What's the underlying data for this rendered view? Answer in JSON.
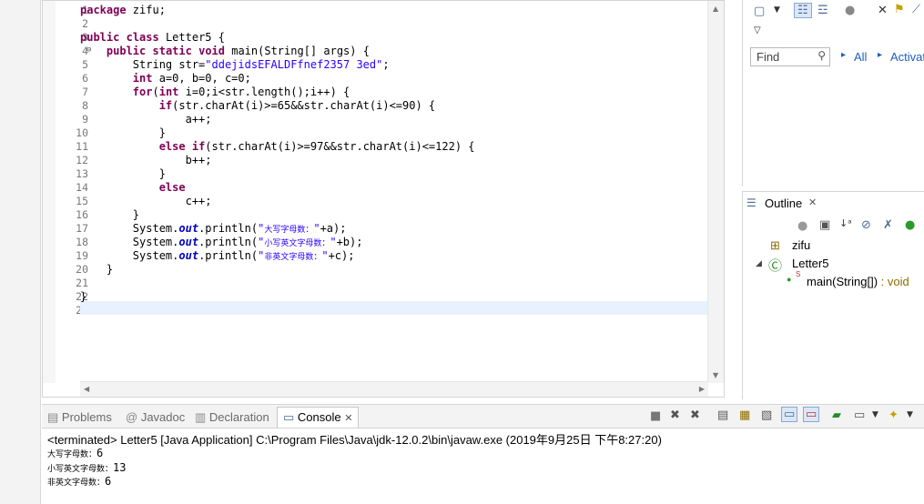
{
  "editor": {
    "line_numbers": [
      "1",
      "2",
      "3",
      "4",
      "5",
      "6",
      "7",
      "8",
      "9",
      "10",
      "11",
      "12",
      "13",
      "14",
      "15",
      "16",
      "17",
      "18",
      "19",
      "20",
      "21",
      "22",
      "23"
    ],
    "lines": [
      "package zifu;",
      "",
      "public class Letter5 {",
      "    public static void main(String[] args) {",
      "        String str=\"ddejidsEFALDFfnef2357 3ed\";",
      "        int a=0, b=0, c=0;",
      "        for(int i=0;i<str.length();i++) {",
      "            if(str.charAt(i)>=65&&str.charAt(i)<=90) {",
      "                a++;",
      "            }",
      "            else if(str.charAt(i)>=97&&str.charAt(i)<=122) {",
      "                b++;",
      "            }",
      "            else",
      "                c++;",
      "        }",
      "        System.out.println(\"大写字母数：\"+a);",
      "        System.out.println(\"小写英文字母数：\"+b);",
      "        System.out.println(\"非英文字母数：\"+c);",
      "    }",
      "",
      "}",
      ""
    ],
    "fold_marker": "⊖"
  },
  "right_toolbar": {
    "find_placeholder": "Find",
    "all_label": "All",
    "activate_label": "Activat"
  },
  "outline": {
    "tab_label": "Outline",
    "package": "zifu",
    "class": "Letter5",
    "method_name": "main(String[])",
    "method_type": " : void"
  },
  "bottom_tabs": {
    "problems": "Problems",
    "javadoc": "Javadoc",
    "declaration": "Declaration",
    "console": "Console"
  },
  "console": {
    "terminated": "<terminated> Letter5 [Java Application] C:\\Program Files\\Java\\jdk-12.0.2\\bin\\javaw.exe (2019年9月25日 下午8:27:20)",
    "out1_label": "大写字母数：",
    "out1_value": "6",
    "out2_label": "小写英文字母数：",
    "out2_value": "13",
    "out3_label": "非英文字母数：",
    "out3_value": "6"
  },
  "colors": {
    "keyword": "#7f0055",
    "string": "#2a00ff",
    "field": "#0000c0",
    "current_line": "#e8f2fe",
    "link": "#1a5ec2"
  }
}
